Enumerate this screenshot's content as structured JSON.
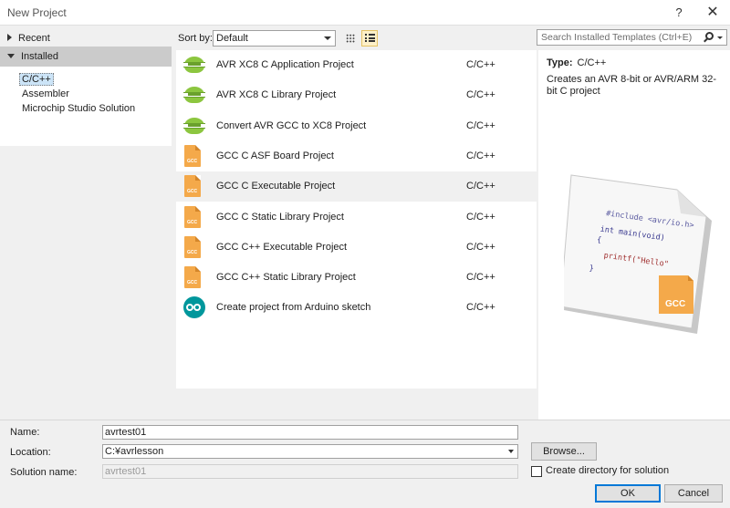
{
  "window": {
    "title": "New Project",
    "help_glyph": "?",
    "close_glyph": "✕"
  },
  "left": {
    "recent_label": "Recent",
    "installed_label": "Installed",
    "tree": [
      "C/C++",
      "Assembler",
      "Microchip Studio Solution"
    ],
    "selected_index": 0
  },
  "toolbar": {
    "sort_label": "Sort by:",
    "sort_value": "Default"
  },
  "templates": [
    {
      "name": "AVR XC8 C Application Project",
      "lang": "C/C++",
      "icon": "avr-xc8-icon"
    },
    {
      "name": "AVR XC8 C Library Project",
      "lang": "C/C++",
      "icon": "avr-xc8-icon"
    },
    {
      "name": "Convert AVR GCC to XC8 Project",
      "lang": "C/C++",
      "icon": "avr-xc8-icon"
    },
    {
      "name": "GCC C ASF Board Project",
      "lang": "C/C++",
      "icon": "gcc-file-icon"
    },
    {
      "name": "GCC C Executable Project",
      "lang": "C/C++",
      "icon": "gcc-file-icon"
    },
    {
      "name": "GCC C Static Library Project",
      "lang": "C/C++",
      "icon": "gcc-file-icon"
    },
    {
      "name": "GCC C++ Executable Project",
      "lang": "C/C++",
      "icon": "gcc-file-icon"
    },
    {
      "name": "GCC C++ Static Library Project",
      "lang": "C/C++",
      "icon": "gcc-file-icon"
    },
    {
      "name": "Create project from Arduino sketch",
      "lang": "C/C++",
      "icon": "arduino-icon"
    }
  ],
  "selected_template": 4,
  "search": {
    "placeholder": "Search Installed Templates (Ctrl+E)"
  },
  "details": {
    "type_label": "Type:",
    "type_value": "C/C++",
    "description": "Creates an AVR 8-bit or AVR/ARM 32-bit C project",
    "preview": {
      "line1": "#include <avr/io.h>",
      "line2": "int main(void)",
      "line3": "{",
      "line4": "printf(\"Hello\"",
      "line5": "}",
      "badge": "GCC"
    }
  },
  "form": {
    "name_label": "Name:",
    "name_value": "avrtest01",
    "location_label": "Location:",
    "location_value": "C:¥avrlesson",
    "solution_label": "Solution name:",
    "solution_value": "avrtest01",
    "browse_label": "Browse...",
    "create_dir_label": "Create directory for solution",
    "ok_label": "OK",
    "cancel_label": "Cancel"
  },
  "icon_glyphs": {
    "avr_badge": "AVR"
  }
}
